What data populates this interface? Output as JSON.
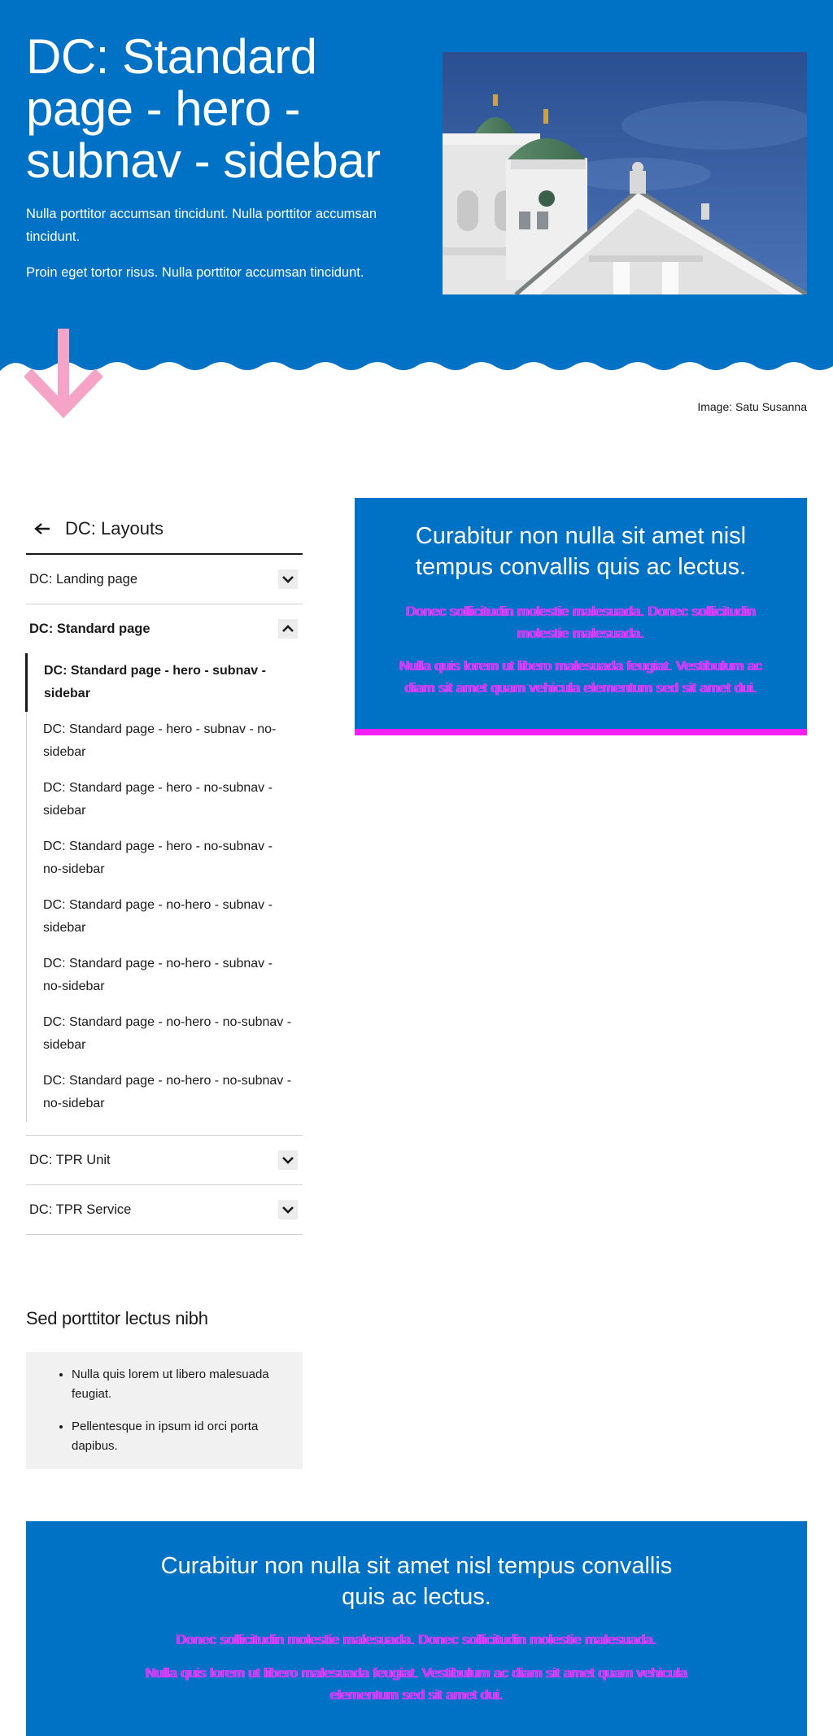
{
  "hero": {
    "title": "DC: Standard page - hero - subnav - sidebar",
    "paragraphs": [
      "Nulla porttitor accumsan tincidunt. Nulla porttitor accumsan tincidunt.",
      "Proin eget tortor risus. Nulla porttitor accumsan tincidunt."
    ],
    "image_credit": "Image: Satu Susanna",
    "image_subject": "cathedral-photo"
  },
  "subnav": {
    "back_label": "DC: Layouts",
    "items": [
      {
        "label": "DC: Landing page"
      },
      {
        "label": "DC: Standard page"
      },
      {
        "label": "DC: TPR Unit"
      },
      {
        "label": "DC: TPR Service"
      }
    ],
    "sub_items": [
      "DC: Standard page - hero - subnav - sidebar",
      "DC: Standard page - hero - subnav - no-sidebar",
      "DC: Standard page - hero - no-subnav - sidebar",
      "DC: Standard page - hero - no-subnav - no-sidebar",
      "DC: Standard page - no-hero - subnav - sidebar",
      "DC: Standard page - no-hero - subnav - no-sidebar",
      "DC: Standard page - no-hero - no-subnav - sidebar",
      "DC: Standard page - no-hero - no-subnav - no-sidebar"
    ]
  },
  "sidebar": {
    "heading": "Sed porttitor lectus nibh",
    "items": [
      "Nulla quis lorem ut libero malesuada feugiat.",
      "Pellentesque in ipsum id orci porta dapibus."
    ]
  },
  "card": {
    "title": "Curabitur non nulla sit amet nisl tempus convallis quis ac lectus.",
    "p1": "Donec sollicitudin molestie malesuada. Donec sollicitudin molestie malesuada.",
    "p2": "Nulla quis lorem ut libero malesuada feugiat. Vestibulum ac diam sit amet quam vehicula elementum sed sit amet dui."
  },
  "banner": {
    "title": "Curabitur non nulla sit amet nisl tempus convallis quis ac lectus.",
    "p1": "Donec sollicitudin molestie malesuada. Donec sollicitudin molestie malesuada.",
    "p2": "Nulla quis lorem ut libero malesuada feugiat. Vestibulum ac diam sit amet quam vehicula elementum sed sit amet dui."
  },
  "colors": {
    "brand_blue": "#0072c6",
    "accent_pink": "#f31ff3",
    "arrow_pink": "#f5a3c7"
  }
}
